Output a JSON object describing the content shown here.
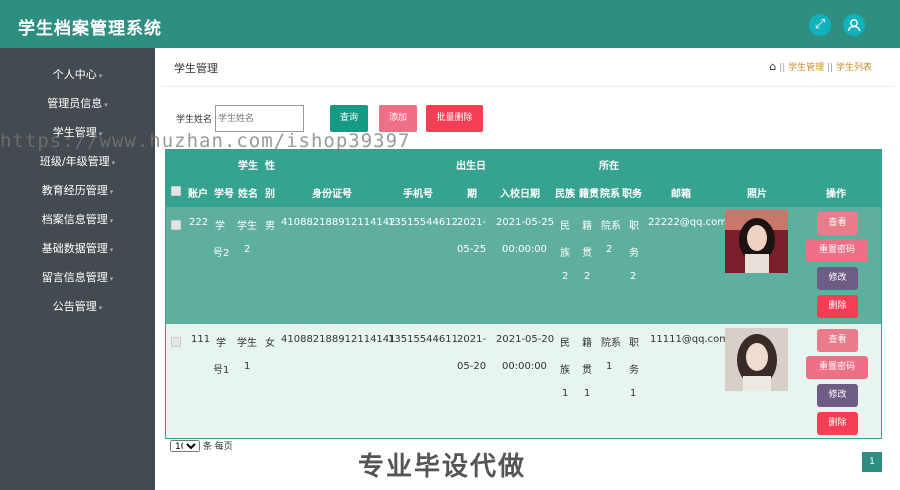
{
  "app": {
    "title": "学生档案管理系统",
    "header_icons": [
      "expand-icon",
      "user-icon"
    ]
  },
  "sidebar": {
    "items": [
      {
        "label": "个人中心"
      },
      {
        "label": "管理员信息"
      },
      {
        "label": "学生管理"
      },
      {
        "label": "班级/年级管理"
      },
      {
        "label": "教育经历管理"
      },
      {
        "label": "档案信息管理"
      },
      {
        "label": "基础数据管理"
      },
      {
        "label": "留言信息管理"
      },
      {
        "label": "公告管理"
      }
    ]
  },
  "page": {
    "title": "学生管理"
  },
  "breadcrumb": {
    "sep1": "||",
    "item1": "学生管理",
    "sep2": "||",
    "item2": "学生列表"
  },
  "search": {
    "label": "学生姓名",
    "placeholder": "学生姓名",
    "query_btn": "查询",
    "add_btn": "添加",
    "batch_delete_btn": "批量删除"
  },
  "table": {
    "headers": {
      "account": "账户",
      "student_no": "学号",
      "student_no_top": "学生",
      "name": "姓名",
      "gender_top": "性",
      "gender": "别",
      "id_card": "身份证号",
      "phone": "手机号",
      "birth_top": "出生日",
      "birth": "期",
      "enroll_date": "入校日期",
      "nation": "民族",
      "native": "籍贯",
      "dept_top": "所在",
      "dept": "院系",
      "position": "职务",
      "email": "邮箱",
      "photo": "照片",
      "action": "操作"
    },
    "rows": [
      {
        "account": "222",
        "student_no": [
          "学",
          "号2"
        ],
        "name": [
          "学生",
          "2"
        ],
        "gender": "男",
        "id_card": "410882188912114142",
        "phone": "13515544612",
        "birth": [
          "2021-",
          "05-25"
        ],
        "enroll_date": [
          "2021-05-25",
          "00:00:00"
        ],
        "nation": [
          "民",
          "族",
          "2"
        ],
        "native": [
          "籍",
          "贯",
          "2"
        ],
        "dept": [
          "院系",
          "2"
        ],
        "position": [
          "职",
          "务",
          "2"
        ],
        "email": "22222@qq.com"
      },
      {
        "account": "111",
        "student_no": [
          "学",
          "号1"
        ],
        "name": [
          "学生",
          "1"
        ],
        "gender": "女",
        "id_card": "410882188912114141",
        "phone": "13515544611",
        "birth": [
          "2021-",
          "05-20"
        ],
        "enroll_date": [
          "2021-05-20",
          "00:00:00"
        ],
        "nation": [
          "民",
          "族",
          "1"
        ],
        "native": [
          "籍",
          "贯",
          "1"
        ],
        "dept": [
          "院系",
          "1"
        ],
        "position": [
          "职",
          "务",
          "1"
        ],
        "email": "11111@qq.com"
      }
    ],
    "actions": {
      "view": "查看",
      "reset_password": "重置密码",
      "edit": "修改",
      "delete": "删除"
    }
  },
  "pagination": {
    "page_size": "10",
    "per_page_label": "条 每页",
    "current_page": "1"
  },
  "watermark": "https://www.huzhan.com/ishop39397",
  "overlay_text": "专业毕设代做",
  "colors": {
    "header": "#2e8f80",
    "sidebar": "#434a50",
    "query": "#179a85",
    "add": "#ee6f86",
    "batch_delete": "#f53d53",
    "view": "#e87c8a",
    "edit": "#6d5d84",
    "delete": "#f53d53"
  }
}
